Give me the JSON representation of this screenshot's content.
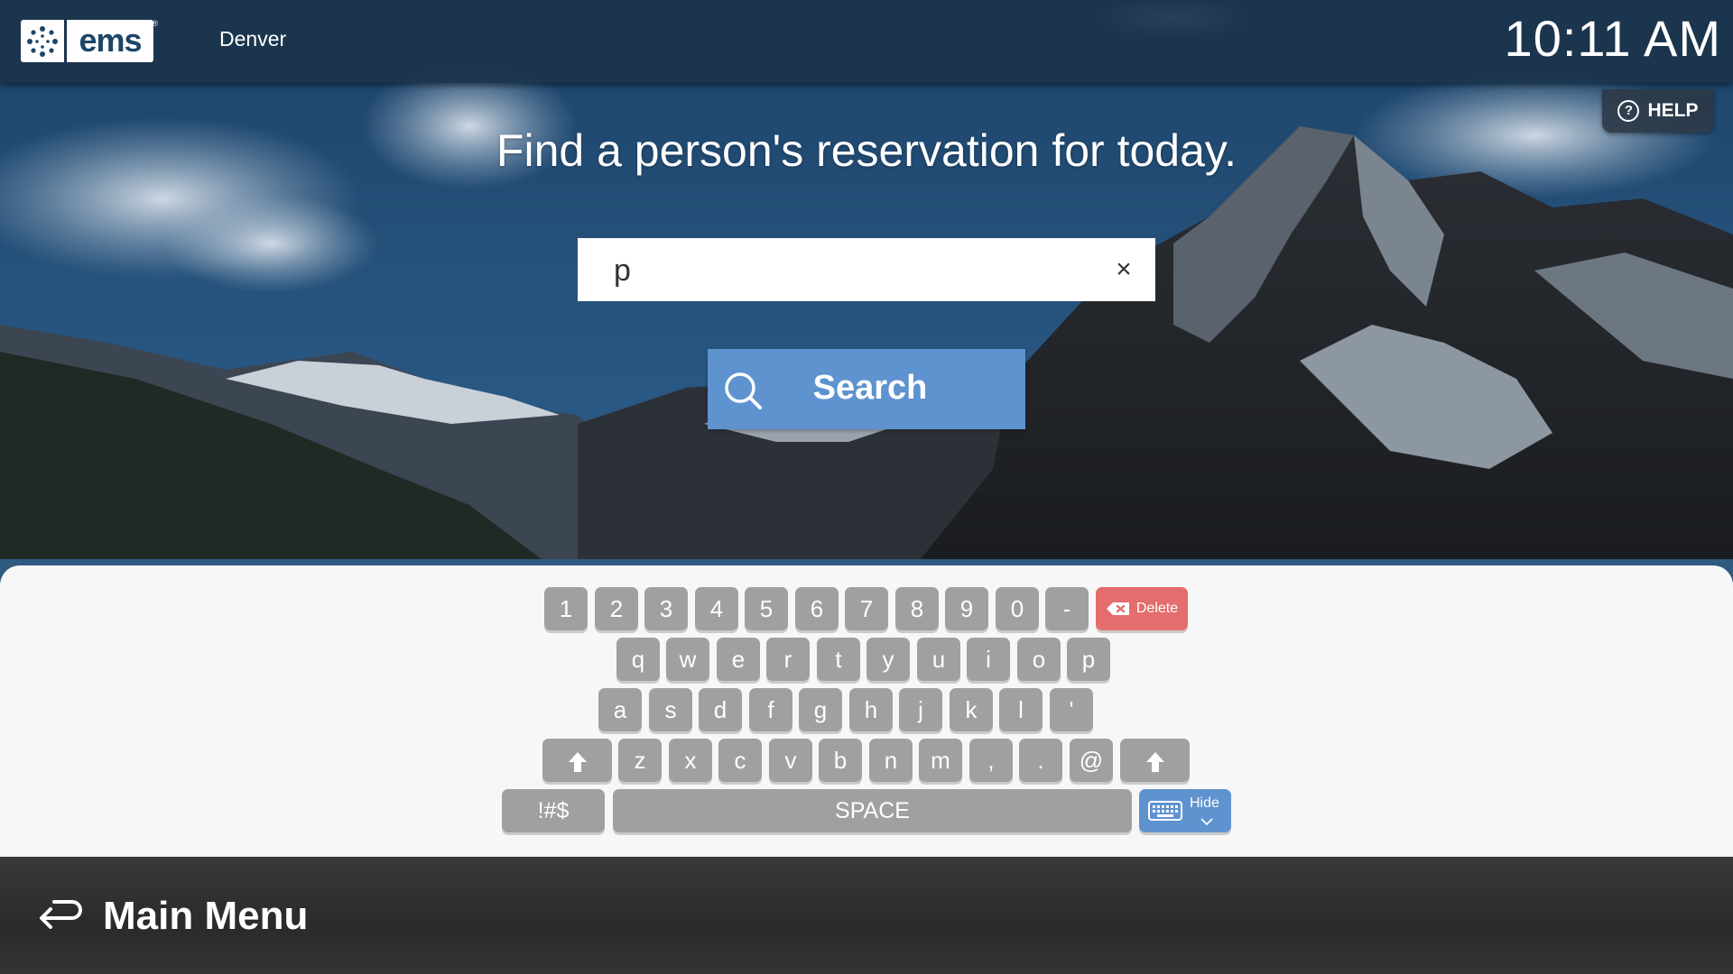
{
  "header": {
    "logo_text": "ems",
    "logo_reg": "®",
    "location": "Denver",
    "clock": "10:11 AM",
    "help_label": "HELP",
    "help_icon": "?"
  },
  "main": {
    "headline": "Find a person's reservation for today.",
    "search_value": "p",
    "clear_icon": "×",
    "search_button_label": "Search"
  },
  "keyboard": {
    "row1": [
      "1",
      "2",
      "3",
      "4",
      "5",
      "6",
      "7",
      "8",
      "9",
      "0",
      "-"
    ],
    "delete_label": "Delete",
    "row2": [
      "q",
      "w",
      "e",
      "r",
      "t",
      "y",
      "u",
      "i",
      "o",
      "p"
    ],
    "row3": [
      "a",
      "s",
      "d",
      "f",
      "g",
      "h",
      "j",
      "k",
      "l",
      "'"
    ],
    "row4": [
      "z",
      "x",
      "c",
      "v",
      "b",
      "n",
      "m",
      ",",
      ".",
      "@"
    ],
    "symbols_label": "!#$",
    "space_label": "SPACE",
    "hide_label": "Hide",
    "colors": {
      "key": "#a0a0a0",
      "delete": "#e46d6d",
      "hide": "#5e93d0"
    }
  },
  "footer": {
    "main_menu_label": "Main Menu"
  },
  "colors": {
    "accent": "#5e93d0",
    "header_bg": "#1c344c",
    "footer_bg": "#373737"
  }
}
